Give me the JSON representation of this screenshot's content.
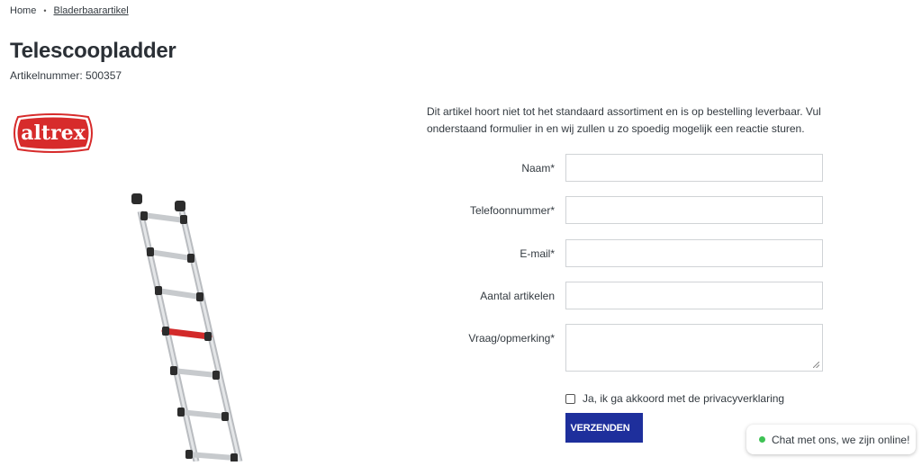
{
  "breadcrumb": {
    "home": "Home",
    "separator": "•",
    "current": "Bladerbaarartikel"
  },
  "product": {
    "title": "Telescoopladder",
    "article_number": "Artikelnummer: 500357",
    "brand_logo_text": "altrex",
    "image_icon": "telescopic-ladder-image"
  },
  "form": {
    "intro": "Dit artikel hoort niet tot het standaard assortiment en is op bestelling leverbaar. Vul onderstaand formulier in en wij zullen u zo spoedig mogelijk een reactie sturen.",
    "fields": [
      {
        "label": "Naam*",
        "value": ""
      },
      {
        "label": "Telefoonnummer*",
        "value": ""
      },
      {
        "label": "E-mail*",
        "value": ""
      },
      {
        "label": "Aantal artikelen",
        "value": ""
      },
      {
        "label": "Vraag/opmerking*",
        "value": ""
      }
    ],
    "privacy_label": "Ja, ik ga akkoord met de privacyverklaring",
    "submit_label": "VERZENDEN",
    "submit_icon": "chevron-right-icon"
  },
  "chat": {
    "label": "Chat met ons, we zijn online!",
    "status_color": "#3ec254"
  },
  "colors": {
    "brand_red": "#d72b2b",
    "submit_blue": "#1e2f9c",
    "text": "#333a40"
  }
}
